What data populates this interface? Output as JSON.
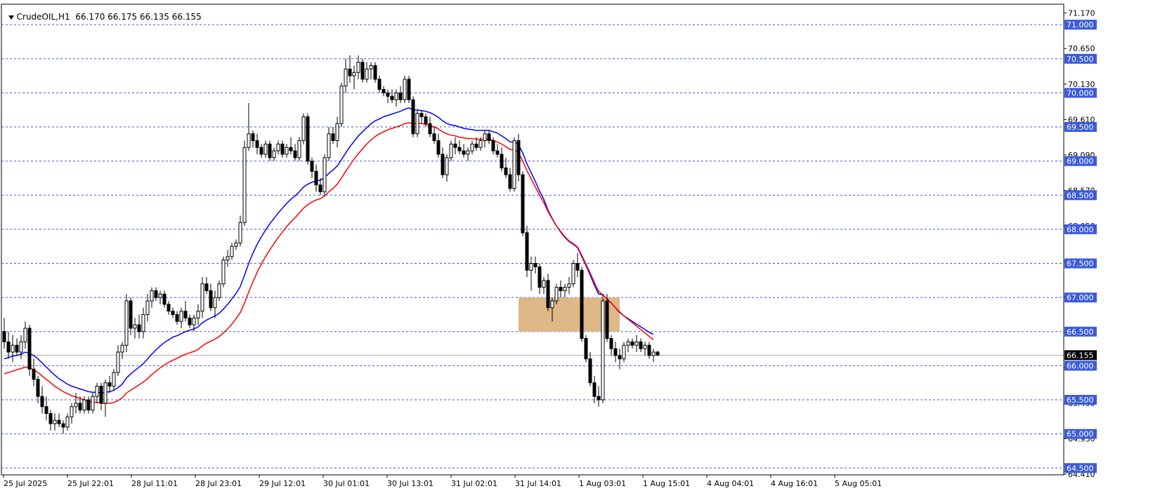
{
  "header": {
    "symbol": "CrudeOIL,H1",
    "ohlc": "66.170 66.175 66.135 66.155"
  },
  "colors": {
    "ema_fast": "#0000ff",
    "ema_slow": "#ff0000",
    "grid_dashed": "#3b5bdb",
    "zone_fill": "#deb887",
    "candle": "#000000",
    "price_tag_bg": "#000000"
  },
  "chart_data": {
    "type": "candlestick",
    "title": "CrudeOIL,H1",
    "ylim": [
      64.4,
      71.3
    ],
    "grid": "horizontal dashed at 0.5 levels",
    "last_price": 66.155,
    "last_price_label": "66.155",
    "y_axis_ticks": [
      "71.170",
      "70.650",
      "70.130",
      "69.610",
      "69.090",
      "68.570",
      "68.050",
      "67.530",
      "67.010",
      "66.490",
      "65.970",
      "65.450",
      "64.930",
      "64.410"
    ],
    "y_axis_ticks_values": [
      71.17,
      70.65,
      70.13,
      69.61,
      69.09,
      68.57,
      68.05,
      67.53,
      67.01,
      66.49,
      65.97,
      65.45,
      64.93,
      64.41
    ],
    "level_lines": [
      71.0,
      70.5,
      70.0,
      69.5,
      69.0,
      68.5,
      68.0,
      67.5,
      67.0,
      66.5,
      66.0,
      65.5,
      65.0,
      64.5
    ],
    "level_labels": [
      "71.000",
      "70.500",
      "70.000",
      "69.500",
      "69.000",
      "68.500",
      "68.000",
      "67.500",
      "67.000",
      "66.500",
      "66.000",
      "65.500",
      "65.000",
      "64.500"
    ],
    "x_tick_labels": [
      "25 Jul 2025",
      "25 Jul 22:01",
      "28 Jul 11:01",
      "28 Jul 23:01",
      "29 Jul 12:01",
      "30 Jul 01:01",
      "30 Jul 13:01",
      "31 Jul 02:01",
      "31 Jul 14:01",
      "1 Aug 03:01",
      "1 Aug 15:01",
      "4 Aug 04:01",
      "4 Aug 16:01",
      "5 Aug 05:01"
    ],
    "zone": {
      "from_bar": 122,
      "to_bar": 146,
      "low": 66.5,
      "high": 67.0
    },
    "candles": [
      [
        66.5,
        66.7,
        66.25,
        66.35
      ],
      [
        66.35,
        66.5,
        66.1,
        66.2
      ],
      [
        66.2,
        66.45,
        66.05,
        66.3
      ],
      [
        66.3,
        66.4,
        66.15,
        66.2
      ],
      [
        66.2,
        66.45,
        66.1,
        66.35
      ],
      [
        66.35,
        66.65,
        66.25,
        66.55
      ],
      [
        66.55,
        66.6,
        65.85,
        65.95
      ],
      [
        65.95,
        66.1,
        65.7,
        65.8
      ],
      [
        65.8,
        65.85,
        65.45,
        65.55
      ],
      [
        65.55,
        65.7,
        65.3,
        65.4
      ],
      [
        65.4,
        65.55,
        65.2,
        65.3
      ],
      [
        65.3,
        65.35,
        65.05,
        65.15
      ],
      [
        65.15,
        65.3,
        65.05,
        65.2
      ],
      [
        65.2,
        65.3,
        65.1,
        65.15
      ],
      [
        65.15,
        65.2,
        65.0,
        65.1
      ],
      [
        65.1,
        65.3,
        65.05,
        65.25
      ],
      [
        65.25,
        65.45,
        65.15,
        65.4
      ],
      [
        65.4,
        65.6,
        65.3,
        65.45
      ],
      [
        65.45,
        65.55,
        65.3,
        65.35
      ],
      [
        65.35,
        65.55,
        65.3,
        65.5
      ],
      [
        65.5,
        65.55,
        65.3,
        65.35
      ],
      [
        65.35,
        65.6,
        65.3,
        65.55
      ],
      [
        65.55,
        65.75,
        65.45,
        65.7
      ],
      [
        65.7,
        65.75,
        65.35,
        65.45
      ],
      [
        65.45,
        65.8,
        65.25,
        65.75
      ],
      [
        65.75,
        65.85,
        65.6,
        65.7
      ],
      [
        65.7,
        65.95,
        65.65,
        65.9
      ],
      [
        65.9,
        66.3,
        65.85,
        66.2
      ],
      [
        66.2,
        66.35,
        66.1,
        66.3
      ],
      [
        66.3,
        67.05,
        66.2,
        66.95
      ],
      [
        66.95,
        67.0,
        66.45,
        66.55
      ],
      [
        66.55,
        66.7,
        66.4,
        66.6
      ],
      [
        66.6,
        66.75,
        66.4,
        66.5
      ],
      [
        66.5,
        66.85,
        66.4,
        66.75
      ],
      [
        66.75,
        67.05,
        66.65,
        66.95
      ],
      [
        66.95,
        67.15,
        66.85,
        67.1
      ],
      [
        67.1,
        67.15,
        66.95,
        67.0
      ],
      [
        67.0,
        67.1,
        66.9,
        67.05
      ],
      [
        67.05,
        67.1,
        66.85,
        66.9
      ],
      [
        66.9,
        66.95,
        66.75,
        66.8
      ],
      [
        66.8,
        66.85,
        66.7,
        66.75
      ],
      [
        66.75,
        66.8,
        66.6,
        66.65
      ],
      [
        66.65,
        66.85,
        66.55,
        66.8
      ],
      [
        66.8,
        66.95,
        66.65,
        66.7
      ],
      [
        66.7,
        66.75,
        66.55,
        66.6
      ],
      [
        66.6,
        66.75,
        66.5,
        66.7
      ],
      [
        66.7,
        66.9,
        66.6,
        66.8
      ],
      [
        66.8,
        67.3,
        66.7,
        67.2
      ],
      [
        67.2,
        67.3,
        67.05,
        67.1
      ],
      [
        67.1,
        67.2,
        66.8,
        66.85
      ],
      [
        66.85,
        67.1,
        66.7,
        67.0
      ],
      [
        67.0,
        67.25,
        66.95,
        67.2
      ],
      [
        67.2,
        67.6,
        67.15,
        67.55
      ],
      [
        67.55,
        67.7,
        67.45,
        67.6
      ],
      [
        67.6,
        67.8,
        67.55,
        67.75
      ],
      [
        67.75,
        67.85,
        67.7,
        67.8
      ],
      [
        67.8,
        68.2,
        67.75,
        68.1
      ],
      [
        68.1,
        69.3,
        68.05,
        69.2
      ],
      [
        69.2,
        69.85,
        69.15,
        69.4
      ],
      [
        69.4,
        69.45,
        69.2,
        69.3
      ],
      [
        69.3,
        69.4,
        69.1,
        69.2
      ],
      [
        69.2,
        69.25,
        69.05,
        69.1
      ],
      [
        69.1,
        69.3,
        69.05,
        69.25
      ],
      [
        69.25,
        69.3,
        69.0,
        69.05
      ],
      [
        69.05,
        69.2,
        69.0,
        69.15
      ],
      [
        69.15,
        69.3,
        69.1,
        69.25
      ],
      [
        69.25,
        69.3,
        69.05,
        69.1
      ],
      [
        69.1,
        69.25,
        69.05,
        69.2
      ],
      [
        69.2,
        69.35,
        69.1,
        69.15
      ],
      [
        69.15,
        69.25,
        69.0,
        69.05
      ],
      [
        69.05,
        69.35,
        69.0,
        69.3
      ],
      [
        69.3,
        69.7,
        69.25,
        69.65
      ],
      [
        69.65,
        69.7,
        68.95,
        69.0
      ],
      [
        69.0,
        69.05,
        68.75,
        68.85
      ],
      [
        68.85,
        68.95,
        68.55,
        68.65
      ],
      [
        68.65,
        68.75,
        68.5,
        68.55
      ],
      [
        68.55,
        69.1,
        68.5,
        69.05
      ],
      [
        69.05,
        69.5,
        69.0,
        69.4
      ],
      [
        69.4,
        69.5,
        69.25,
        69.3
      ],
      [
        69.3,
        69.65,
        69.2,
        69.55
      ],
      [
        69.55,
        70.15,
        69.5,
        70.1
      ],
      [
        70.1,
        70.5,
        70.0,
        70.35
      ],
      [
        70.35,
        70.55,
        70.15,
        70.25
      ],
      [
        70.25,
        70.4,
        70.05,
        70.3
      ],
      [
        70.3,
        70.55,
        70.2,
        70.45
      ],
      [
        70.45,
        70.5,
        70.15,
        70.2
      ],
      [
        70.2,
        70.45,
        70.15,
        70.35
      ],
      [
        70.35,
        70.45,
        70.2,
        70.4
      ],
      [
        70.4,
        70.45,
        70.15,
        70.2
      ],
      [
        70.2,
        70.25,
        70.0,
        70.05
      ],
      [
        70.05,
        70.1,
        69.95,
        70.0
      ],
      [
        70.0,
        70.05,
        69.85,
        69.95
      ],
      [
        69.95,
        70.05,
        69.85,
        69.9
      ],
      [
        69.9,
        70.05,
        69.8,
        70.0
      ],
      [
        70.0,
        70.1,
        69.85,
        69.9
      ],
      [
        69.9,
        70.25,
        69.85,
        70.2
      ],
      [
        70.2,
        70.25,
        69.85,
        69.9
      ],
      [
        69.9,
        69.95,
        69.35,
        69.4
      ],
      [
        69.4,
        69.75,
        69.35,
        69.7
      ],
      [
        69.7,
        69.75,
        69.55,
        69.65
      ],
      [
        69.65,
        69.7,
        69.5,
        69.55
      ],
      [
        69.55,
        69.65,
        69.35,
        69.4
      ],
      [
        69.4,
        69.5,
        69.25,
        69.3
      ],
      [
        69.3,
        69.4,
        69.05,
        69.1
      ],
      [
        69.1,
        69.2,
        68.75,
        68.8
      ],
      [
        68.8,
        69.1,
        68.7,
        69.05
      ],
      [
        69.05,
        69.3,
        69.0,
        69.25
      ],
      [
        69.25,
        69.35,
        69.1,
        69.2
      ],
      [
        69.2,
        69.3,
        69.1,
        69.15
      ],
      [
        69.15,
        69.25,
        69.05,
        69.1
      ],
      [
        69.1,
        69.2,
        69.0,
        69.15
      ],
      [
        69.15,
        69.3,
        69.1,
        69.25
      ],
      [
        69.25,
        69.35,
        69.15,
        69.2
      ],
      [
        69.2,
        69.35,
        69.15,
        69.3
      ],
      [
        69.3,
        69.45,
        69.2,
        69.4
      ],
      [
        69.4,
        69.45,
        69.25,
        69.3
      ],
      [
        69.3,
        69.35,
        69.1,
        69.15
      ],
      [
        69.15,
        69.25,
        69.05,
        69.1
      ],
      [
        69.1,
        69.2,
        68.85,
        68.9
      ],
      [
        68.9,
        69.05,
        68.75,
        68.8
      ],
      [
        68.8,
        68.9,
        68.55,
        68.6
      ],
      [
        68.6,
        69.35,
        68.55,
        69.3
      ],
      [
        69.3,
        69.4,
        68.7,
        68.8
      ],
      [
        68.8,
        68.85,
        67.9,
        67.95
      ],
      [
        67.95,
        68.05,
        67.3,
        67.4
      ],
      [
        67.4,
        67.6,
        67.1,
        67.5
      ],
      [
        67.5,
        67.6,
        67.35,
        67.45
      ],
      [
        67.45,
        67.5,
        67.05,
        67.15
      ],
      [
        67.15,
        67.3,
        67.05,
        67.25
      ],
      [
        67.25,
        67.35,
        66.8,
        66.85
      ],
      [
        66.85,
        67.0,
        66.65,
        66.95
      ],
      [
        66.95,
        67.2,
        66.9,
        67.15
      ],
      [
        67.15,
        67.25,
        67.0,
        67.1
      ],
      [
        67.1,
        67.2,
        67.0,
        67.15
      ],
      [
        67.15,
        67.3,
        67.05,
        67.2
      ],
      [
        67.2,
        67.55,
        67.15,
        67.5
      ],
      [
        67.5,
        67.65,
        67.3,
        67.4
      ],
      [
        67.4,
        67.45,
        66.35,
        66.4
      ],
      [
        66.4,
        66.45,
        66.05,
        66.1
      ],
      [
        66.1,
        66.2,
        65.7,
        65.75
      ],
      [
        65.75,
        65.85,
        65.45,
        65.55
      ],
      [
        65.55,
        65.7,
        65.4,
        65.5
      ],
      [
        65.5,
        67.05,
        65.45,
        66.95
      ],
      [
        66.95,
        67.05,
        66.35,
        66.4
      ],
      [
        66.4,
        66.45,
        66.15,
        66.25
      ],
      [
        66.25,
        66.35,
        66.05,
        66.15
      ],
      [
        66.15,
        66.25,
        65.95,
        66.1
      ],
      [
        66.1,
        66.35,
        66.05,
        66.3
      ],
      [
        66.3,
        66.4,
        66.2,
        66.35
      ],
      [
        66.35,
        66.4,
        66.25,
        66.3
      ],
      [
        66.3,
        66.45,
        66.2,
        66.35
      ],
      [
        66.35,
        66.4,
        66.2,
        66.25
      ],
      [
        66.25,
        66.35,
        66.15,
        66.3
      ],
      [
        66.3,
        66.35,
        66.1,
        66.15
      ],
      [
        66.15,
        66.25,
        66.05,
        66.2
      ],
      [
        66.2,
        66.22,
        66.14,
        66.155
      ]
    ],
    "series": [
      {
        "name": "",
        "values": [
          66.1,
          66.12,
          66.14,
          66.15,
          66.17,
          66.2,
          66.18,
          66.15,
          66.1,
          66.04,
          65.98,
          65.92,
          65.86,
          65.81,
          65.77,
          65.73,
          65.7,
          65.68,
          65.66,
          65.64,
          65.62,
          65.61,
          65.61,
          65.6,
          65.61,
          65.62,
          65.64,
          65.68,
          65.73,
          65.82,
          65.88,
          65.93,
          65.98,
          66.03,
          66.1,
          66.17,
          66.23,
          66.29,
          66.34,
          66.38,
          66.42,
          66.44,
          66.47,
          66.5,
          66.52,
          66.54,
          66.57,
          66.63,
          66.67,
          66.7,
          66.73,
          66.77,
          66.83,
          66.9,
          66.98,
          67.06,
          67.16,
          67.33,
          67.5,
          67.65,
          67.78,
          67.89,
          67.99,
          68.08,
          68.16,
          68.24,
          68.31,
          68.38,
          68.44,
          68.49,
          68.55,
          68.62,
          68.66,
          68.69,
          68.71,
          68.72,
          68.76,
          68.82,
          68.87,
          68.93,
          69.02,
          69.12,
          69.21,
          69.29,
          69.37,
          69.43,
          69.49,
          69.55,
          69.59,
          69.62,
          69.65,
          69.67,
          69.69,
          69.71,
          69.73,
          69.76,
          69.78,
          69.75,
          69.75,
          69.74,
          69.73,
          69.71,
          69.68,
          69.64,
          69.59,
          69.55,
          69.53,
          69.52,
          69.5,
          69.48,
          69.47,
          69.46,
          69.45,
          69.45,
          69.45,
          69.45,
          69.43,
          69.41,
          69.37,
          69.33,
          69.28,
          69.28,
          69.24,
          69.12,
          68.96,
          68.83,
          68.7,
          68.56,
          68.44,
          68.28,
          68.16,
          68.05,
          67.96,
          67.88,
          67.82,
          67.78,
          67.73,
          67.6,
          67.47,
          67.33,
          67.18,
          67.05,
          67.04,
          66.98,
          66.92,
          66.85,
          66.78,
          66.73,
          66.69,
          66.65,
          66.61,
          66.57,
          66.53,
          66.49,
          66.46
        ]
      },
      {
        "name": "",
        "values": [
          65.88,
          65.9,
          65.92,
          65.94,
          65.96,
          65.98,
          65.97,
          65.94,
          65.9,
          65.85,
          65.8,
          65.75,
          65.7,
          65.66,
          65.62,
          65.59,
          65.56,
          65.54,
          65.52,
          65.5,
          65.48,
          65.47,
          65.46,
          65.45,
          65.45,
          65.45,
          65.46,
          65.49,
          65.53,
          65.6,
          65.64,
          65.68,
          65.72,
          65.76,
          65.81,
          65.87,
          65.92,
          65.97,
          66.01,
          66.05,
          66.08,
          66.11,
          66.14,
          66.17,
          66.19,
          66.21,
          66.24,
          66.29,
          66.33,
          66.36,
          66.39,
          66.43,
          66.48,
          66.54,
          66.61,
          66.69,
          66.78,
          66.92,
          67.08,
          67.23,
          67.37,
          67.49,
          67.6,
          67.7,
          67.79,
          67.88,
          67.96,
          68.04,
          68.11,
          68.17,
          68.24,
          68.31,
          68.36,
          68.4,
          68.43,
          68.45,
          68.49,
          68.55,
          68.6,
          68.66,
          68.75,
          68.85,
          68.94,
          69.03,
          69.11,
          69.18,
          69.25,
          69.31,
          69.36,
          69.4,
          69.43,
          69.46,
          69.48,
          69.5,
          69.52,
          69.55,
          69.56,
          69.55,
          69.55,
          69.55,
          69.54,
          69.52,
          69.5,
          69.47,
          69.43,
          69.4,
          69.38,
          69.37,
          69.35,
          69.34,
          69.33,
          69.33,
          69.32,
          69.32,
          69.32,
          69.32,
          69.3,
          69.28,
          69.25,
          69.21,
          69.17,
          69.17,
          69.12,
          69.0,
          68.86,
          68.74,
          68.62,
          68.5,
          68.39,
          68.26,
          68.15,
          68.05,
          67.97,
          67.89,
          67.83,
          67.79,
          67.74,
          67.62,
          67.49,
          67.36,
          67.22,
          67.09,
          67.04,
          66.98,
          66.92,
          66.85,
          66.79,
          66.73,
          66.68,
          66.63,
          66.58,
          66.53,
          66.48,
          66.43,
          66.38
        ]
      }
    ]
  }
}
